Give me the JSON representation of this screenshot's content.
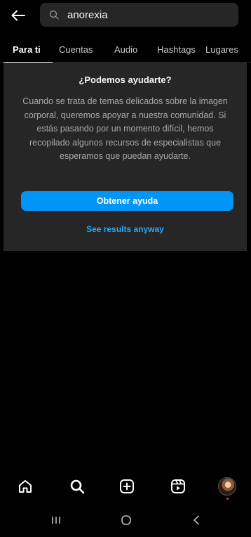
{
  "search": {
    "value": "anorexia"
  },
  "tabs": [
    {
      "label": "Para ti"
    },
    {
      "label": "Cuentas"
    },
    {
      "label": "Audio"
    },
    {
      "label": "Hashtags"
    },
    {
      "label": "Lugares"
    }
  ],
  "panel": {
    "title": "¿Podemos ayudarte?",
    "body": "Cuando se trata de temas delicados sobre la imagen corporal, queremos apoyar a nuestra comunidad. Si estás pasando por un momento difícil, hemos recopilado algunos recursos de especialistas que esperamos que puedan ayudarte.",
    "button_label": "Obtener ayuda",
    "secondary_link": "See results anyway"
  },
  "icons": {
    "back": "arrow-left-icon",
    "search": "search-icon",
    "nav": [
      "home-icon",
      "search-icon",
      "create-post-icon",
      "reels-icon",
      "profile-avatar"
    ],
    "system": [
      "recent-apps-icon",
      "home-circle-icon",
      "back-chevron-icon"
    ]
  },
  "colors": {
    "background": "#000000",
    "panel": "#262626",
    "accent": "#0095f6",
    "link": "#2aa7f6",
    "notification": "#ff3040"
  }
}
